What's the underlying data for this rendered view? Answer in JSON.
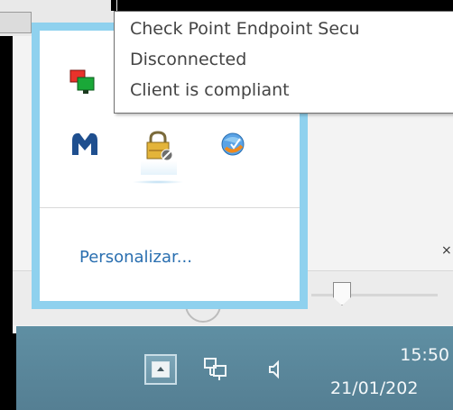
{
  "tooltip": {
    "line1": "Check Point Endpoint Secu",
    "line2": "Disconnected",
    "line3": "Client is compliant"
  },
  "tray": {
    "customize_link": "Personalizar...",
    "icons": [
      {
        "name": "network-monitor-icon",
        "color": "#e8322b"
      },
      {
        "name": "malwarebytes-icon",
        "color": "#1f4f8f"
      },
      {
        "name": "check-point-lock-icon",
        "color": "#d6a51f"
      },
      {
        "name": "secure-browser-icon",
        "color": "#3a7fd0"
      }
    ]
  },
  "taskbar": {
    "time": "15:50",
    "date": "21/01/202",
    "icons": [
      "show-hidden-icons-icon",
      "network-icon",
      "volume-icon"
    ]
  },
  "background": {
    "close_glyph": "×"
  },
  "colors": {
    "taskbar": "#5f8fa3",
    "tray_border": "#8fd1ee",
    "link": "#2a6fb0"
  }
}
